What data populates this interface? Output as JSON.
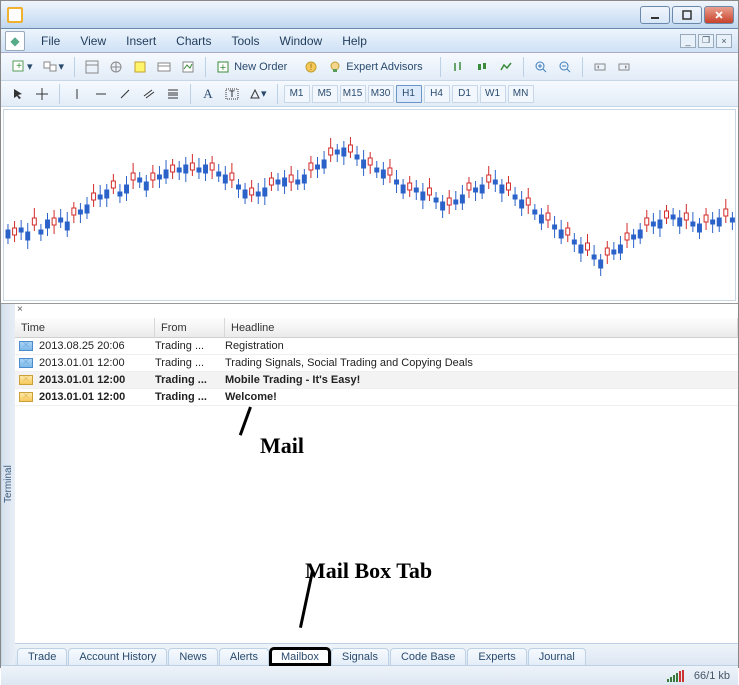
{
  "window": {
    "title": ""
  },
  "menu": {
    "file": "File",
    "view": "View",
    "insert": "Insert",
    "charts": "Charts",
    "tools": "Tools",
    "window": "Window",
    "help": "Help"
  },
  "toolbar": {
    "new_order": "New Order",
    "expert_advisors": "Expert Advisors"
  },
  "timeframes": {
    "m1": "M1",
    "m5": "M5",
    "m15": "M15",
    "m30": "M30",
    "h1": "H1",
    "h4": "H4",
    "d1": "D1",
    "w1": "W1",
    "mn": "MN"
  },
  "terminal": {
    "label": "Terminal"
  },
  "grid": {
    "headers": {
      "time": "Time",
      "from": "From",
      "headline": "Headline"
    },
    "rows": [
      {
        "time": "2013.08.25 20:06",
        "from": "Trading ...",
        "headline": "Registration",
        "unread": false
      },
      {
        "time": "2013.01.01 12:00",
        "from": "Trading ...",
        "headline": "Trading Signals, Social Trading and Copying Deals",
        "unread": false
      },
      {
        "time": "2013.01.01 12:00",
        "from": "Trading ...",
        "headline": "Mobile Trading - It's Easy!",
        "unread": true
      },
      {
        "time": "2013.01.01 12:00",
        "from": "Trading ...",
        "headline": "Welcome!",
        "unread": true
      }
    ]
  },
  "tabs": {
    "trade": "Trade",
    "account_history": "Account History",
    "news": "News",
    "alerts": "Alerts",
    "mailbox": "Mailbox",
    "signals": "Signals",
    "code_base": "Code Base",
    "experts": "Experts",
    "journal": "Journal"
  },
  "status": {
    "bandwidth": "66/1 kb"
  },
  "annotations": {
    "mail": "Mail",
    "mailbox_tab": "Mail Box Tab"
  }
}
